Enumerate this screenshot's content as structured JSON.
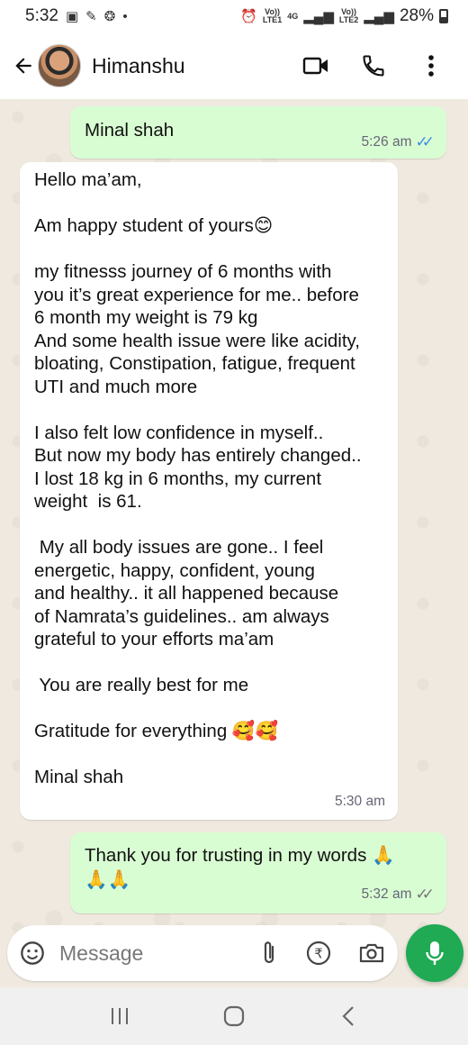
{
  "status_bar": {
    "time": "5:32",
    "carrier1_top": "Vo))",
    "carrier1_bottom": "LTE1",
    "network": "4G",
    "carrier2_top": "Vo))",
    "carrier2_bottom": "LTE2",
    "battery": "28%"
  },
  "header": {
    "contact_name": "Himanshu",
    "icons": [
      "back-arrow-icon",
      "video-call-icon",
      "phone-call-icon",
      "more-options-icon"
    ]
  },
  "messages": [
    {
      "direction": "outgoing",
      "lines": [
        "Minal shah"
      ],
      "time": "5:26 am",
      "status": "read"
    },
    {
      "direction": "incoming",
      "lines": [
        "Hello ma’am,",
        "",
        "Am happy student of yours😊",
        "",
        "my fitnesss journey of 6 months with",
        "you it’s great experience for me.. before",
        "6 month my weight is 79 kg",
        "And some health issue were like acidity,",
        "bloating, Constipation, fatigue, frequent",
        "UTI and much more",
        "",
        "I also felt low confidence in myself..",
        "But now my body has entirely changed..",
        "I lost 18 kg in 6 months, my current",
        "weight  is 61.",
        "",
        " My all body issues are gone.. I feel",
        "energetic, happy, confident, young",
        "and healthy.. it all happened because",
        "of Namrata’s guidelines.. am always",
        "grateful to your efforts ma’am",
        "",
        " You are really best for me",
        "",
        "Gratitude for everything 🥰🥰",
        "",
        "Minal shah"
      ],
      "time": "5:30 am"
    },
    {
      "direction": "outgoing",
      "lines": [
        "Thank you for trusting in my words 🙏",
        "🙏🙏"
      ],
      "time": "5:32 am",
      "status": "delivered"
    }
  ],
  "input": {
    "placeholder": "Message",
    "icons": [
      "sticker-icon",
      "attach-icon",
      "rupee-payment-icon",
      "camera-icon",
      "mic-icon"
    ]
  },
  "nav": {
    "icons": [
      "recent-apps-icon",
      "home-icon",
      "back-icon"
    ]
  },
  "colors": {
    "outgoing_bubble": "#d9fdd3",
    "incoming_bubble": "#ffffff",
    "read_ticks": "#3f8de0",
    "mic_button": "#1faa53"
  }
}
